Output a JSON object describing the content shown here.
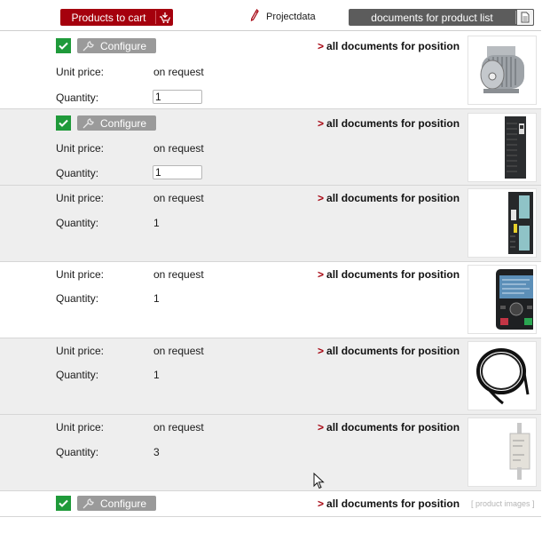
{
  "toolbar": {
    "products_to_cart_label": "Products to cart",
    "cart_icon": "cart-download-icon",
    "projectdata_label": "Projectdata",
    "projectdata_icon": "pencil-icon",
    "documents_label": "documents for product list",
    "documents_icon": "document-icon"
  },
  "labels": {
    "unit_price": "Unit price:",
    "quantity": "Quantity:",
    "configure": "Configure",
    "all_documents": "all documents for position",
    "product_images_placeholder": "[ product images ]"
  },
  "colors": {
    "brand_red": "#a5000d",
    "dark_grey_button": "#5c5c5c",
    "configure_grey": "#9a9a9a",
    "check_green": "#1f9a3a",
    "row_alt": "#eeeeee"
  },
  "positions": [
    {
      "configurable": true,
      "unit_price": "on request",
      "quantity": "1",
      "quantity_editable": true,
      "image": "motor"
    },
    {
      "configurable": true,
      "unit_price": "on request",
      "quantity": "1",
      "quantity_editable": true,
      "image": "inverter-power-module"
    },
    {
      "configurable": false,
      "unit_price": "on request",
      "quantity": "1",
      "quantity_editable": false,
      "image": "control-unit"
    },
    {
      "configurable": false,
      "unit_price": "on request",
      "quantity": "1",
      "quantity_editable": false,
      "image": "operator-panel"
    },
    {
      "configurable": false,
      "unit_price": "on request",
      "quantity": "1",
      "quantity_editable": false,
      "image": "cable"
    },
    {
      "configurable": false,
      "unit_price": "on request",
      "quantity": "3",
      "quantity_editable": false,
      "image": "fuse"
    },
    {
      "configurable": true,
      "image": null
    }
  ]
}
